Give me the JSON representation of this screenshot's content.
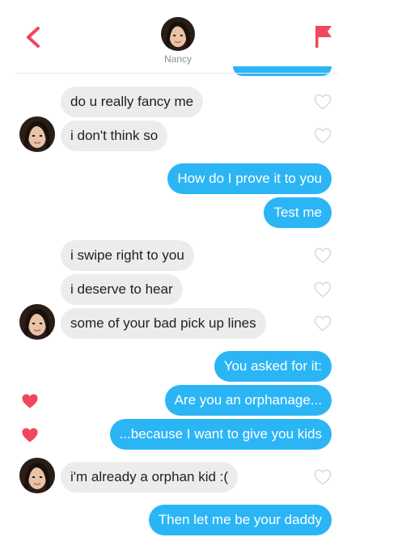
{
  "header": {
    "contact_name": "Nancy",
    "back_icon": "chevron-left-icon",
    "report_icon": "flag-icon",
    "accent_color": "#f0475f"
  },
  "messages": [
    {
      "from": "them",
      "text": "do u really fancy me",
      "liked": false
    },
    {
      "from": "them",
      "text": "i don't think so",
      "liked": false
    },
    {
      "from": "me",
      "text": "How do I prove it to you"
    },
    {
      "from": "me",
      "text": "Test me"
    },
    {
      "from": "them",
      "text": "i swipe right to you",
      "liked": false
    },
    {
      "from": "them",
      "text": "i deserve to hear",
      "liked": false
    },
    {
      "from": "them",
      "text": "some of your bad pick up lines",
      "liked": false
    },
    {
      "from": "me",
      "text": "You asked for it:"
    },
    {
      "from": "me",
      "text": "Are you an orphanage...",
      "liked_by_them": true
    },
    {
      "from": "me",
      "text": "...because I want to give you kids",
      "liked_by_them": true
    },
    {
      "from": "them",
      "text": "i'm already a orphan kid :(",
      "liked": false
    },
    {
      "from": "me",
      "text": "Then let me be your daddy"
    }
  ],
  "colors": {
    "outgoing_bubble": "#2bb5f5",
    "incoming_bubble": "#ececec",
    "heart_liked": "#f0475f",
    "heart_outline": "#d9d9d9"
  }
}
